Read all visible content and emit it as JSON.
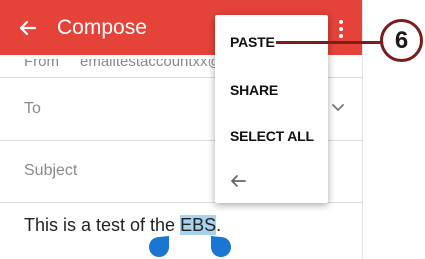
{
  "appbar": {
    "title": "Compose",
    "background": "#e5433a"
  },
  "from": {
    "label": "From",
    "value": "emailtestaccountxx@"
  },
  "to": {
    "label": "To"
  },
  "subject": {
    "placeholder": "Subject"
  },
  "body": {
    "text_before": "This is a test of the ",
    "selected": "EBS",
    "text_after": "."
  },
  "menu": {
    "items": [
      "PASTE",
      "SHARE",
      "SELECT ALL"
    ],
    "back_icon": "arrow-left-icon"
  },
  "callout": {
    "number": "6",
    "color": "#7b1d1d"
  },
  "icons": {
    "back": "arrow-left-icon",
    "more": "more-vert-icon",
    "chevron": "chevron-down-icon"
  }
}
